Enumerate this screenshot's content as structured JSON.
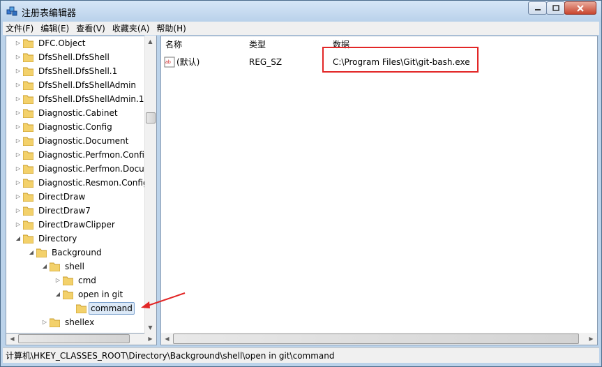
{
  "window": {
    "title": "注册表编辑器"
  },
  "menu": [
    "文件(F)",
    "编辑(E)",
    "查看(V)",
    "收藏夹(A)",
    "帮助(H)"
  ],
  "tree": {
    "rows": [
      {
        "label": "DFC.Object"
      },
      {
        "label": "DfsShell.DfsShell"
      },
      {
        "label": "DfsShell.DfsShell.1"
      },
      {
        "label": "DfsShell.DfsShellAdmin"
      },
      {
        "label": "DfsShell.DfsShellAdmin.1"
      },
      {
        "label": "Diagnostic.Cabinet"
      },
      {
        "label": "Diagnostic.Config"
      },
      {
        "label": "Diagnostic.Document"
      },
      {
        "label": "Diagnostic.Perfmon.Config"
      },
      {
        "label": "Diagnostic.Perfmon.Docur"
      },
      {
        "label": "Diagnostic.Resmon.Config"
      },
      {
        "label": "DirectDraw"
      },
      {
        "label": "DirectDraw7"
      },
      {
        "label": "DirectDrawClipper"
      },
      {
        "label": "Directory"
      },
      {
        "label": "Background"
      },
      {
        "label": "shell"
      },
      {
        "label": "cmd"
      },
      {
        "label": "open in git"
      },
      {
        "label": "command"
      },
      {
        "label": "shellex"
      }
    ]
  },
  "list": {
    "columns": [
      "名称",
      "类型",
      "数据"
    ],
    "rows": [
      {
        "name": "(默认)",
        "type": "REG_SZ",
        "data": "C:\\Program Files\\Git\\git-bash.exe"
      }
    ]
  },
  "status": {
    "path": "计算机\\HKEY_CLASSES_ROOT\\Directory\\Background\\shell\\open in git\\command"
  },
  "colors": {
    "highlight": "#e22626",
    "selection": "#dce9f7"
  }
}
